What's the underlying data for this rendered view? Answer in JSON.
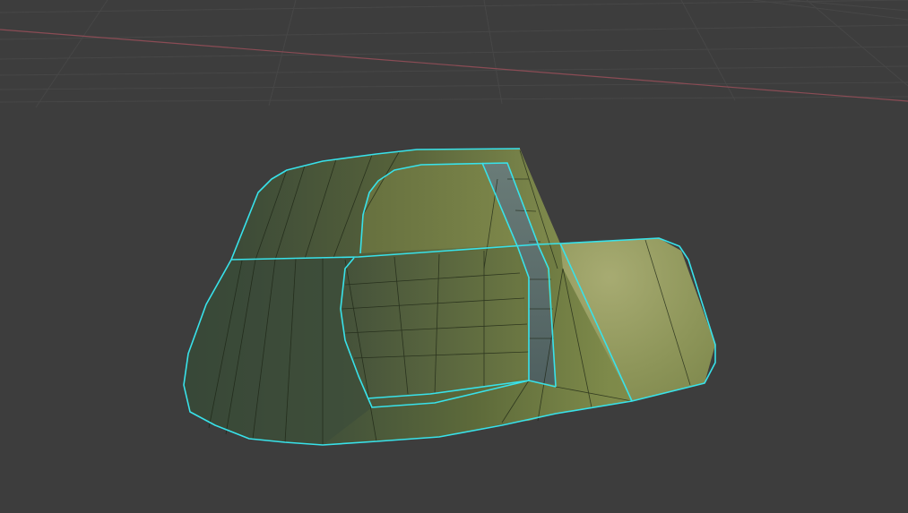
{
  "app": {
    "name": "3D Viewport",
    "mode": "edit-mode",
    "selection_color": "#38e2ea",
    "background_color": "#3d3d3d",
    "grid_color": "#4a4a4a",
    "x_axis_color": "#8b4c55"
  },
  "mesh": {
    "object_name": "",
    "face_color_light": "#a3a86e",
    "face_color_mid": "#6f7b45",
    "face_color_dark": "#3b4a38",
    "recessed_color": "#5c7070",
    "wire_color": "#1c2414"
  },
  "icons": {
    "grid": "viewport-grid",
    "axis": "x-axis-line",
    "mesh": "mesh-object"
  }
}
